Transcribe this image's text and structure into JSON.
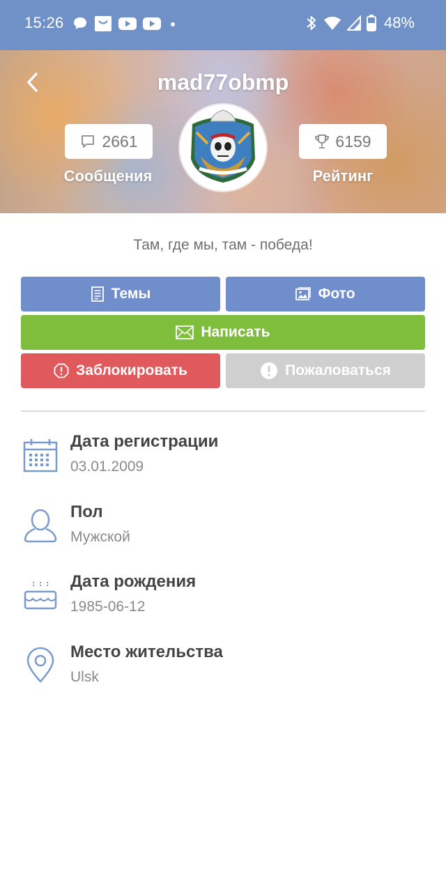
{
  "status_bar": {
    "time": "15:26",
    "battery_percent": "48%",
    "left_icons": [
      "chat-icon",
      "shopping-bag-icon",
      "youtube-icon",
      "youtube-icon",
      "dot-icon"
    ],
    "right_icons": [
      "bluetooth-icon",
      "wifi-icon",
      "signal-icon",
      "battery-icon"
    ]
  },
  "header": {
    "username": "mad77obmp",
    "messages": {
      "count": "2661",
      "label": "Сообщения",
      "icon": "comment-icon"
    },
    "rating": {
      "count": "6159",
      "label": "Рейтинг",
      "icon": "trophy-icon"
    }
  },
  "profile": {
    "motto": "Там, где мы, там - победа!"
  },
  "actions": {
    "topics": "Темы",
    "photo": "Фото",
    "write": "Написать",
    "block": "Заблокировать",
    "report": "Пожаловаться"
  },
  "info": [
    {
      "title": "Дата регистрации",
      "value": "03.01.2009",
      "icon": "calendar-icon"
    },
    {
      "title": "Пол",
      "value": "Мужской",
      "icon": "user-icon"
    },
    {
      "title": "Дата рождения",
      "value": "1985-06-12",
      "icon": "birthday-cake-icon"
    },
    {
      "title": "Место жительства",
      "value": "Ulsk",
      "icon": "location-pin-icon"
    }
  ],
  "colors": {
    "primary": "#6f8ecb",
    "status_bar": "#7090c8",
    "write": "#7fbd3c",
    "block": "#e0595c",
    "report_disabled": "#cfcfcf",
    "icon_stroke": "#7a9acb"
  }
}
